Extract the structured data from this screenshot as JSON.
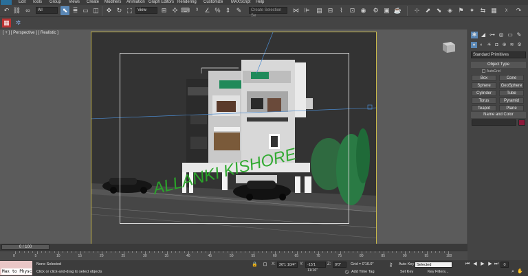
{
  "menubar": {
    "items": [
      "Edit",
      "Tools",
      "Group",
      "Views",
      "Create",
      "Modifiers",
      "Animation",
      "Graph Editors",
      "Rendering",
      "Customize",
      "MAXScript",
      "Help"
    ]
  },
  "toolbar": {
    "filter_value": "All",
    "view_value": "View",
    "selection_set_placeholder": "Create Selection Se"
  },
  "viewport": {
    "label": "[ + ] [ Perspective ] [ Realistic ]",
    "watermark": "ALLANKI KISHORE"
  },
  "command_panel": {
    "dropdown": "Standard Primitives",
    "object_type_header": "Object Type",
    "autogrid": "AutoGrid",
    "buttons": [
      "Box",
      "Cone",
      "Sphere",
      "GeoSphere",
      "Cylinder",
      "Tube",
      "Torus",
      "Pyramid",
      "Teapot",
      "Plane"
    ],
    "name_color_header": "Name and Color",
    "color": "#8c1a3a"
  },
  "timeslider": {
    "label": "0 / 100",
    "ticks": [
      "0",
      "5",
      "10",
      "15",
      "20",
      "25",
      "30",
      "35",
      "40",
      "45",
      "50",
      "55",
      "60",
      "65",
      "70",
      "75",
      "80",
      "85",
      "90",
      "95",
      "100"
    ]
  },
  "statusbar": {
    "maxscript": "Max to Physc",
    "selection": "None Selected",
    "prompt": "Click or click-and-drag to select objects",
    "x_value": "26'1 10/4\"",
    "y_value": "-15'1 11/16\"",
    "z_value": "0'0\"",
    "x_label": "X:",
    "y_label": "Y:",
    "z_label": "Z:",
    "grid": "Grid = 0'10.0\"",
    "add_time_tag": "Add Time Tag",
    "auto_key": "Auto Key",
    "set_key": "Set Key",
    "selected": "Selected",
    "key_filters": "Key Filters...",
    "frame": "0"
  }
}
